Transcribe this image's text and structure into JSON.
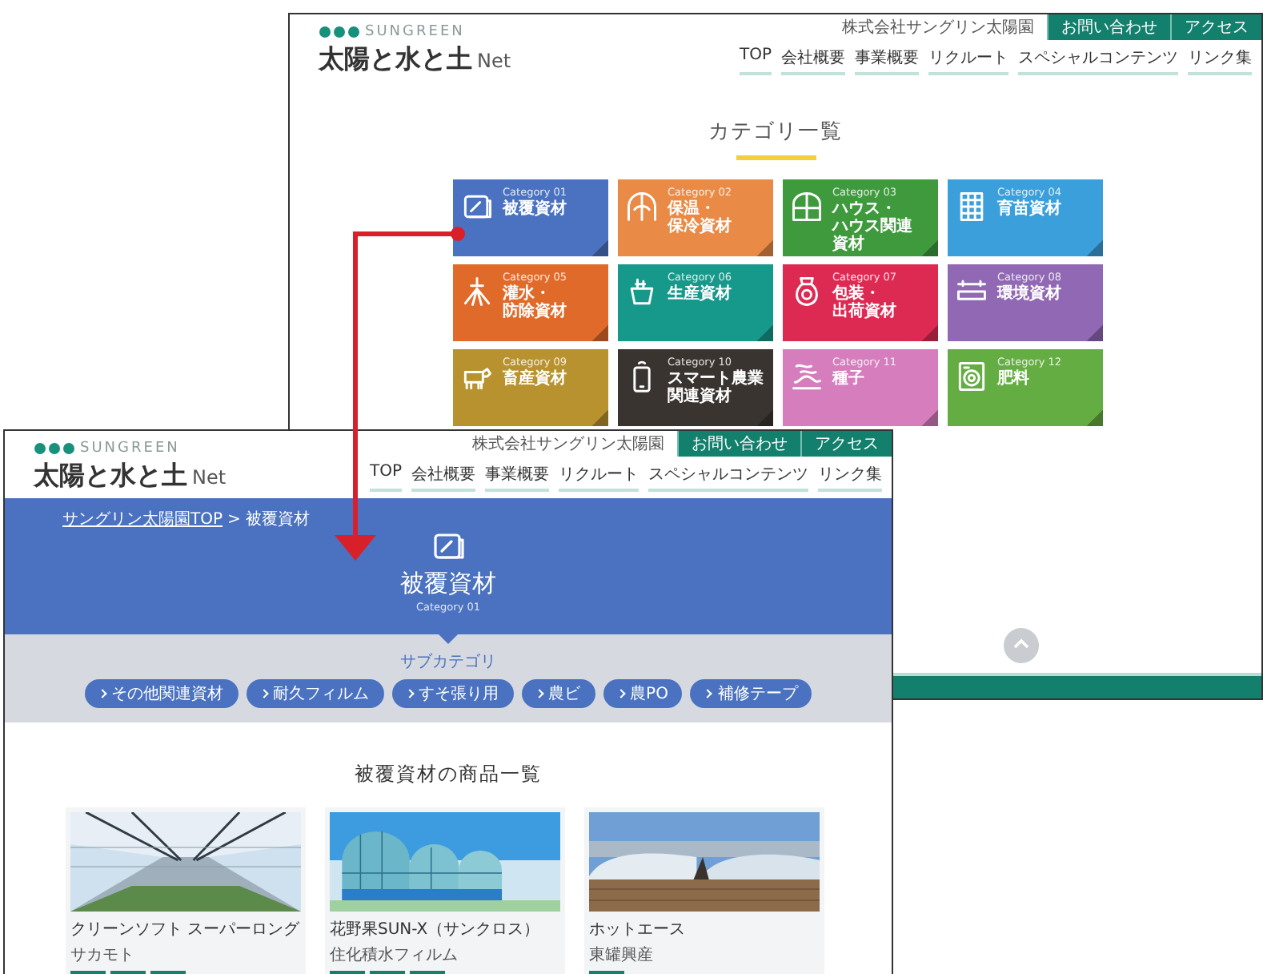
{
  "category_page": {
    "brand": "SUNGREEN",
    "site_title": "太陽と水と土",
    "site_title_suffix": "Net",
    "company": "株式会社サングリン太陽園",
    "header_buttons": [
      "お問い合わせ",
      "アクセス"
    ],
    "nav": [
      "TOP",
      "会社概要",
      "事業概要",
      "リクルート",
      "スペシャルコンテンツ",
      "リンク集"
    ],
    "heading": "カテゴリ一覧",
    "categories": [
      {
        "number": "Category 01",
        "label": [
          "被覆資材"
        ],
        "color": "#4a72c0"
      },
      {
        "number": "Category 02",
        "label": [
          "保温・",
          "保冷資材"
        ],
        "color": "#e98b46"
      },
      {
        "number": "Category 03",
        "label": [
          "ハウス・",
          "ハウス関連",
          "資材"
        ],
        "color": "#3f9a3e"
      },
      {
        "number": "Category 04",
        "label": [
          "育苗資材"
        ],
        "color": "#3a9fdb"
      },
      {
        "number": "Category 05",
        "label": [
          "灌水・",
          "防除資材"
        ],
        "color": "#e06a2a"
      },
      {
        "number": "Category 06",
        "label": [
          "生産資材"
        ],
        "color": "#16988a"
      },
      {
        "number": "Category 07",
        "label": [
          "包装・",
          "出荷資材"
        ],
        "color": "#dd2a52"
      },
      {
        "number": "Category 08",
        "label": [
          "環境資材"
        ],
        "color": "#9068b3"
      },
      {
        "number": "Category 09",
        "label": [
          "畜産資材"
        ],
        "color": "#b8922e"
      },
      {
        "number": "Category 10",
        "label": [
          "スマート農業",
          "関連資材"
        ],
        "color": "#3a3431"
      },
      {
        "number": "Category 11",
        "label": [
          "種子"
        ],
        "color": "#d67dbd"
      },
      {
        "number": "Category 12",
        "label": [
          "肥料"
        ],
        "color": "#64ad42"
      }
    ]
  },
  "detail_page": {
    "brand": "SUNGREEN",
    "site_title": "太陽と水と土",
    "site_title_suffix": "Net",
    "company": "株式会社サングリン太陽園",
    "header_buttons": [
      "お問い合わせ",
      "アクセス"
    ],
    "nav": [
      "TOP",
      "会社概要",
      "事業概要",
      "リクルート",
      "スペシャルコンテンツ",
      "リンク集"
    ],
    "breadcrumb": [
      "サングリン太陽園TOP",
      "被覆資材"
    ],
    "breadcrumb_separator": ">",
    "title": "被覆資材",
    "category_number": "Category 01",
    "subcategory_heading": "サブカテゴリ",
    "subcategories": [
      "その他関連資材",
      "耐久フィルム",
      "すそ張り用",
      "農ビ",
      "農PO",
      "補修テープ"
    ],
    "products_heading": "被覆資材の商品一覧",
    "products": [
      {
        "name": "クリーンソフト スーパーロング",
        "maker": "サカモト"
      },
      {
        "name": "花野果SUN-X（サンクロス）",
        "maker": "住化積水フィルム"
      },
      {
        "name": "ホットエース",
        "maker": "東罐興産"
      }
    ]
  }
}
